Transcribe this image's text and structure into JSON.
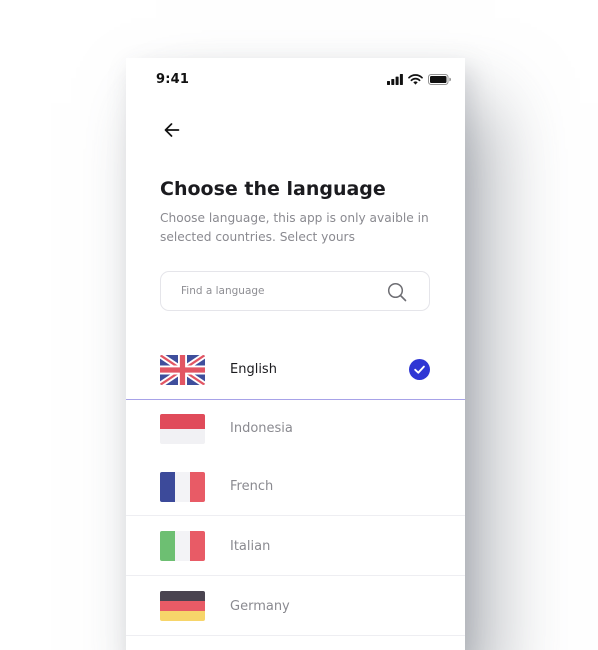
{
  "status_bar": {
    "time": "9:41",
    "icons": [
      "signal-icon",
      "wifi-icon",
      "battery-icon"
    ]
  },
  "header": {
    "back_icon": "arrow-left-icon",
    "title": "Choose the language",
    "subtitle": "Choose language, this app is only avaible in selected countries. Select yours"
  },
  "search": {
    "placeholder": "Find a language",
    "value": "",
    "icon": "search-icon"
  },
  "languages": [
    {
      "label": "English",
      "flag": "uk-flag-icon",
      "selected": true
    },
    {
      "label": "Indonesia",
      "flag": "indonesia-flag-icon",
      "selected": false
    },
    {
      "label": "French",
      "flag": "france-flag-icon",
      "selected": false
    },
    {
      "label": "Italian",
      "flag": "italy-flag-icon",
      "selected": false
    },
    {
      "label": "Germany",
      "flag": "germany-flag-icon",
      "selected": false
    }
  ],
  "colors": {
    "accent": "#2f36d4",
    "selected_divider": "#a7a2e8",
    "text_primary": "#1b1b1f",
    "text_secondary": "#8a8a90"
  }
}
